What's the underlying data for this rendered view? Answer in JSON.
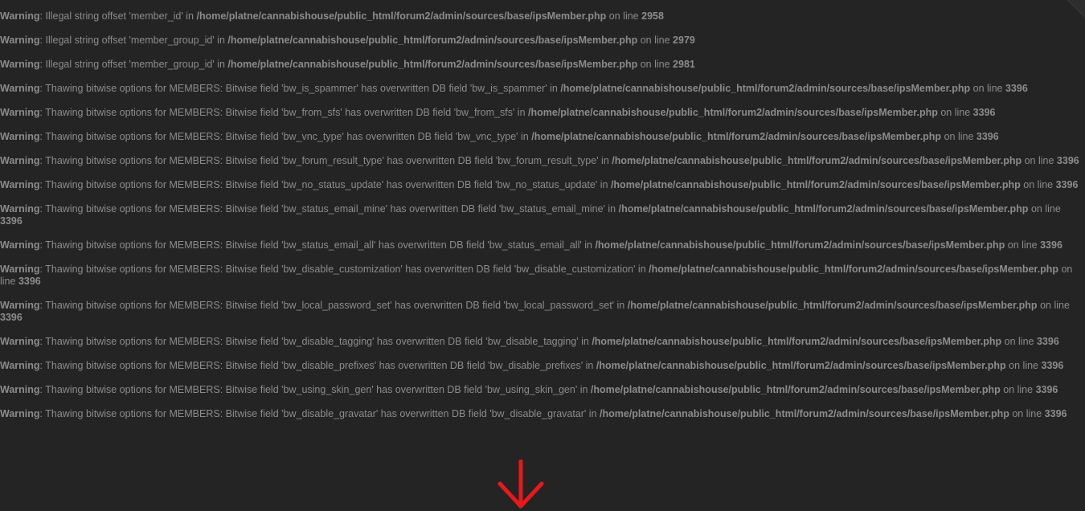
{
  "log": {
    "warnings": [
      {
        "label": "Warning",
        "message": "Illegal string offset 'member_id' in",
        "file": "/home/platne/cannabishouse/public_html/forum2/admin/sources/base/ipsMember.php",
        "on_line": "on line",
        "line": "2958"
      },
      {
        "label": "Warning",
        "message": "Illegal string offset 'member_group_id' in",
        "file": "/home/platne/cannabishouse/public_html/forum2/admin/sources/base/ipsMember.php",
        "on_line": "on line",
        "line": "2979"
      },
      {
        "label": "Warning",
        "message": "Illegal string offset 'member_group_id' in",
        "file": "/home/platne/cannabishouse/public_html/forum2/admin/sources/base/ipsMember.php",
        "on_line": "on line",
        "line": "2981"
      },
      {
        "label": "Warning",
        "message": "Thawing bitwise options for MEMBERS: Bitwise field 'bw_is_spammer' has overwritten DB field 'bw_is_spammer' in",
        "file": "/home/platne/cannabishouse/public_html/forum2/admin/sources/base/ipsMember.php",
        "on_line": "on line",
        "line": "3396"
      },
      {
        "label": "Warning",
        "message": "Thawing bitwise options for MEMBERS: Bitwise field 'bw_from_sfs' has overwritten DB field 'bw_from_sfs' in",
        "file": "/home/platne/cannabishouse/public_html/forum2/admin/sources/base/ipsMember.php",
        "on_line": "on line",
        "line": "3396"
      },
      {
        "label": "Warning",
        "message": "Thawing bitwise options for MEMBERS: Bitwise field 'bw_vnc_type' has overwritten DB field 'bw_vnc_type' in",
        "file": "/home/platne/cannabishouse/public_html/forum2/admin/sources/base/ipsMember.php",
        "on_line": "on line",
        "line": "3396"
      },
      {
        "label": "Warning",
        "message": "Thawing bitwise options for MEMBERS: Bitwise field 'bw_forum_result_type' has overwritten DB field 'bw_forum_result_type' in",
        "file": "/home/platne/cannabishouse/public_html/forum2/admin/sources/base/ipsMember.php",
        "on_line": "on line",
        "line": "3396"
      },
      {
        "label": "Warning",
        "message": "Thawing bitwise options for MEMBERS: Bitwise field 'bw_no_status_update' has overwritten DB field 'bw_no_status_update' in",
        "file": "/home/platne/cannabishouse/public_html/forum2/admin/sources/base/ipsMember.php",
        "on_line": "on line",
        "line": "3396"
      },
      {
        "label": "Warning",
        "message": "Thawing bitwise options for MEMBERS: Bitwise field 'bw_status_email_mine' has overwritten DB field 'bw_status_email_mine' in",
        "file": "/home/platne/cannabishouse/public_html/forum2/admin/sources/base/ipsMember.php",
        "on_line": "on line",
        "line": "3396"
      },
      {
        "label": "Warning",
        "message": "Thawing bitwise options for MEMBERS: Bitwise field 'bw_status_email_all' has overwritten DB field 'bw_status_email_all' in",
        "file": "/home/platne/cannabishouse/public_html/forum2/admin/sources/base/ipsMember.php",
        "on_line": "on line",
        "line": "3396"
      },
      {
        "label": "Warning",
        "message": "Thawing bitwise options for MEMBERS: Bitwise field 'bw_disable_customization' has overwritten DB field 'bw_disable_customization' in",
        "file": "/home/platne/cannabishouse/public_html/forum2/admin/sources/base/ipsMember.php",
        "on_line": "on line",
        "line": "3396"
      },
      {
        "label": "Warning",
        "message": "Thawing bitwise options for MEMBERS: Bitwise field 'bw_local_password_set' has overwritten DB field 'bw_local_password_set' in",
        "file": "/home/platne/cannabishouse/public_html/forum2/admin/sources/base/ipsMember.php",
        "on_line": "on line",
        "line": "3396"
      },
      {
        "label": "Warning",
        "message": "Thawing bitwise options for MEMBERS: Bitwise field 'bw_disable_tagging' has overwritten DB field 'bw_disable_tagging' in",
        "file": "/home/platne/cannabishouse/public_html/forum2/admin/sources/base/ipsMember.php",
        "on_line": "on line",
        "line": "3396"
      },
      {
        "label": "Warning",
        "message": "Thawing bitwise options for MEMBERS: Bitwise field 'bw_disable_prefixes' has overwritten DB field 'bw_disable_prefixes' in",
        "file": "/home/platne/cannabishouse/public_html/forum2/admin/sources/base/ipsMember.php",
        "on_line": "on line",
        "line": "3396"
      },
      {
        "label": "Warning",
        "message": "Thawing bitwise options for MEMBERS: Bitwise field 'bw_using_skin_gen' has overwritten DB field 'bw_using_skin_gen' in",
        "file": "/home/platne/cannabishouse/public_html/forum2/admin/sources/base/ipsMember.php",
        "on_line": "on line",
        "line": "3396"
      },
      {
        "label": "Warning",
        "message": "Thawing bitwise options for MEMBERS: Bitwise field 'bw_disable_gravatar' has overwritten DB field 'bw_disable_gravatar' in",
        "file": "/home/platne/cannabishouse/public_html/forum2/admin/sources/base/ipsMember.php",
        "on_line": "on line",
        "line": "3396"
      }
    ]
  },
  "annotation": {
    "icon": "arrow-down-icon",
    "color": "#e8191b"
  },
  "theme": {
    "background": "#242424",
    "text": "#8c8c8c"
  }
}
